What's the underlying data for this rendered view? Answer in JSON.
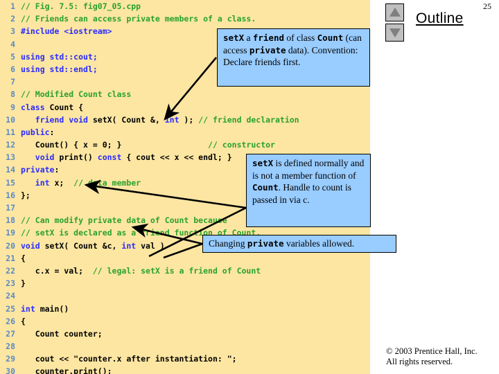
{
  "slide": {
    "page_number": "25",
    "outline_label": "Outline",
    "copyright_line1": "© 2003 Prentice Hall, Inc.",
    "copyright_line2": "All rights reserved."
  },
  "spinners": {
    "up_icon": "triangle-up-icon",
    "down_icon": "triangle-down-icon"
  },
  "code": {
    "lines": [
      {
        "n": "1",
        "tokens": [
          {
            "t": "// Fig. 7.5: fig07_05.cpp",
            "c": "cm"
          }
        ]
      },
      {
        "n": "2",
        "tokens": [
          {
            "t": "// Friends can access private members of a class.",
            "c": "cm"
          }
        ]
      },
      {
        "n": "3",
        "tokens": [
          {
            "t": "#include <iostream>",
            "c": "pp"
          }
        ]
      },
      {
        "n": "4",
        "tokens": [
          {
            "t": "",
            "c": "id"
          }
        ]
      },
      {
        "n": "5",
        "tokens": [
          {
            "t": "using std::cout;",
            "c": "kw"
          }
        ]
      },
      {
        "n": "6",
        "tokens": [
          {
            "t": "using std::endl;",
            "c": "kw"
          }
        ]
      },
      {
        "n": "7",
        "tokens": [
          {
            "t": "",
            "c": "id"
          }
        ]
      },
      {
        "n": "8",
        "tokens": [
          {
            "t": "// Modified Count class",
            "c": "cm"
          }
        ]
      },
      {
        "n": "9",
        "tokens": [
          {
            "t": "class ",
            "c": "kw"
          },
          {
            "t": "Count {",
            "c": "id"
          }
        ]
      },
      {
        "n": "10",
        "tokens": [
          {
            "t": "   friend void ",
            "c": "kw"
          },
          {
            "t": "setX( Count &, ",
            "c": "id"
          },
          {
            "t": "int ",
            "c": "kw"
          },
          {
            "t": "); ",
            "c": "id"
          },
          {
            "t": "// friend declaration",
            "c": "cm"
          }
        ]
      },
      {
        "n": "11",
        "tokens": [
          {
            "t": "public",
            "c": "kw"
          },
          {
            "t": ":",
            "c": "id"
          }
        ]
      },
      {
        "n": "12",
        "tokens": [
          {
            "t": "   Count() { x = 0; }                  ",
            "c": "id"
          },
          {
            "t": "// constructor",
            "c": "cm"
          }
        ]
      },
      {
        "n": "13",
        "tokens": [
          {
            "t": "   void ",
            "c": "kw"
          },
          {
            "t": "print() ",
            "c": "id"
          },
          {
            "t": "const ",
            "c": "kw"
          },
          {
            "t": "{ cout << x << endl; }",
            "c": "id"
          }
        ]
      },
      {
        "n": "14",
        "tokens": [
          {
            "t": "private",
            "c": "kw"
          },
          {
            "t": ":",
            "c": "id"
          }
        ]
      },
      {
        "n": "15",
        "tokens": [
          {
            "t": "   int ",
            "c": "kw"
          },
          {
            "t": "x;  ",
            "c": "id"
          },
          {
            "t": "// data member",
            "c": "cm"
          }
        ]
      },
      {
        "n": "16",
        "tokens": [
          {
            "t": "};",
            "c": "id"
          }
        ]
      },
      {
        "n": "17",
        "tokens": [
          {
            "t": "",
            "c": "id"
          }
        ]
      },
      {
        "n": "18",
        "tokens": [
          {
            "t": "// Can modify private data of Count because",
            "c": "cm"
          }
        ]
      },
      {
        "n": "19",
        "tokens": [
          {
            "t": "// setX is declared as a friend function of Count.",
            "c": "cm"
          }
        ]
      },
      {
        "n": "20",
        "tokens": [
          {
            "t": "void ",
            "c": "kw"
          },
          {
            "t": "setX( Count &c, ",
            "c": "id"
          },
          {
            "t": "int ",
            "c": "kw"
          },
          {
            "t": "val )",
            "c": "id"
          }
        ]
      },
      {
        "n": "21",
        "tokens": [
          {
            "t": "{",
            "c": "id"
          }
        ]
      },
      {
        "n": "22",
        "tokens": [
          {
            "t": "   c.x = val;  ",
            "c": "id"
          },
          {
            "t": "// legal: setX is a friend of Count",
            "c": "cm"
          }
        ]
      },
      {
        "n": "23",
        "tokens": [
          {
            "t": "}",
            "c": "id"
          }
        ]
      },
      {
        "n": "24",
        "tokens": [
          {
            "t": "",
            "c": "id"
          }
        ]
      },
      {
        "n": "25",
        "tokens": [
          {
            "t": "int ",
            "c": "kw"
          },
          {
            "t": "main()",
            "c": "id"
          }
        ]
      },
      {
        "n": "26",
        "tokens": [
          {
            "t": "{",
            "c": "id"
          }
        ]
      },
      {
        "n": "27",
        "tokens": [
          {
            "t": "   Count counter;",
            "c": "id"
          }
        ]
      },
      {
        "n": "28",
        "tokens": [
          {
            "t": "",
            "c": "id"
          }
        ]
      },
      {
        "n": "29",
        "tokens": [
          {
            "t": "   cout << \"counter.x after instantiation: \";",
            "c": "id"
          }
        ]
      },
      {
        "n": "30",
        "tokens": [
          {
            "t": "   counter.print();",
            "c": "id"
          }
        ]
      }
    ]
  },
  "callouts": {
    "friend": {
      "parts": [
        {
          "t": "setX",
          "b": true
        },
        {
          "t": " a ",
          "b": false
        },
        {
          "t": "friend",
          "b": true
        },
        {
          "t": " of class ",
          "b": false
        },
        {
          "t": "Count",
          "b": true
        },
        {
          "t": " (can access ",
          "b": false
        },
        {
          "t": "private",
          "b": true
        },
        {
          "t": " data). Convention: Declare friends first.",
          "b": false
        }
      ]
    },
    "setx": {
      "parts": [
        {
          "t": "setX",
          "b": true
        },
        {
          "t": " is defined normally and is not a member function of ",
          "b": false
        },
        {
          "t": "Count",
          "b": true
        },
        {
          "t": ". Handle to count is passed in via c.",
          "b": false
        }
      ]
    },
    "private": {
      "parts": [
        {
          "t": "Changing ",
          "b": false
        },
        {
          "t": "private",
          "b": true
        },
        {
          "t": " variables allowed.",
          "b": false
        }
      ]
    }
  },
  "colors": {
    "panel_background": "#fce6a2",
    "callout_background": "#99ccff",
    "comment": "#2aa22a",
    "keyword": "#2a2aff",
    "line_number": "#5a8ac6",
    "spinner_face": "#c0c0c0",
    "spinner_arrow": "#808080"
  }
}
